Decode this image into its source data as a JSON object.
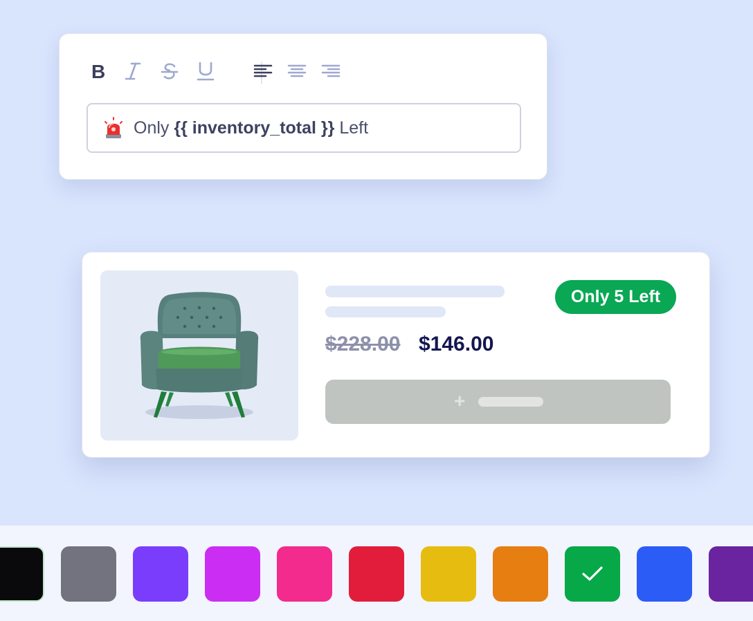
{
  "editor": {
    "toolbar": {
      "bold_icon": "bold-icon",
      "italic_icon": "italic-icon",
      "strikethrough_icon": "strikethrough-icon",
      "underline_icon": "underline-icon",
      "align_left_icon": "align-left-icon",
      "align_center_icon": "align-center-icon",
      "align_right_icon": "align-right-icon"
    },
    "field": {
      "prefix_icon": "siren-icon",
      "text_before": "Only",
      "variable": "{{ inventory_total }}",
      "text_after": "Left"
    }
  },
  "product": {
    "image_alt": "green armchair",
    "old_price": "$228.00",
    "new_price": "$146.00",
    "stock_badge": "Only 5 Left",
    "add_button_icon": "plus-icon",
    "colors": {
      "badge": "#0aa754",
      "price": "#141650",
      "old_price": "#8d90ab"
    }
  },
  "swatches": {
    "colors": [
      "#0a0a0d",
      "#72737e",
      "#7b3dfc",
      "#cb2ef2",
      "#f22b8d",
      "#e11d3b",
      "#e6bc10",
      "#e67e12",
      "#06a848",
      "#2c5cf6",
      "#6a24a0"
    ],
    "selected": "#06a848",
    "selected_icon": "check-icon"
  }
}
